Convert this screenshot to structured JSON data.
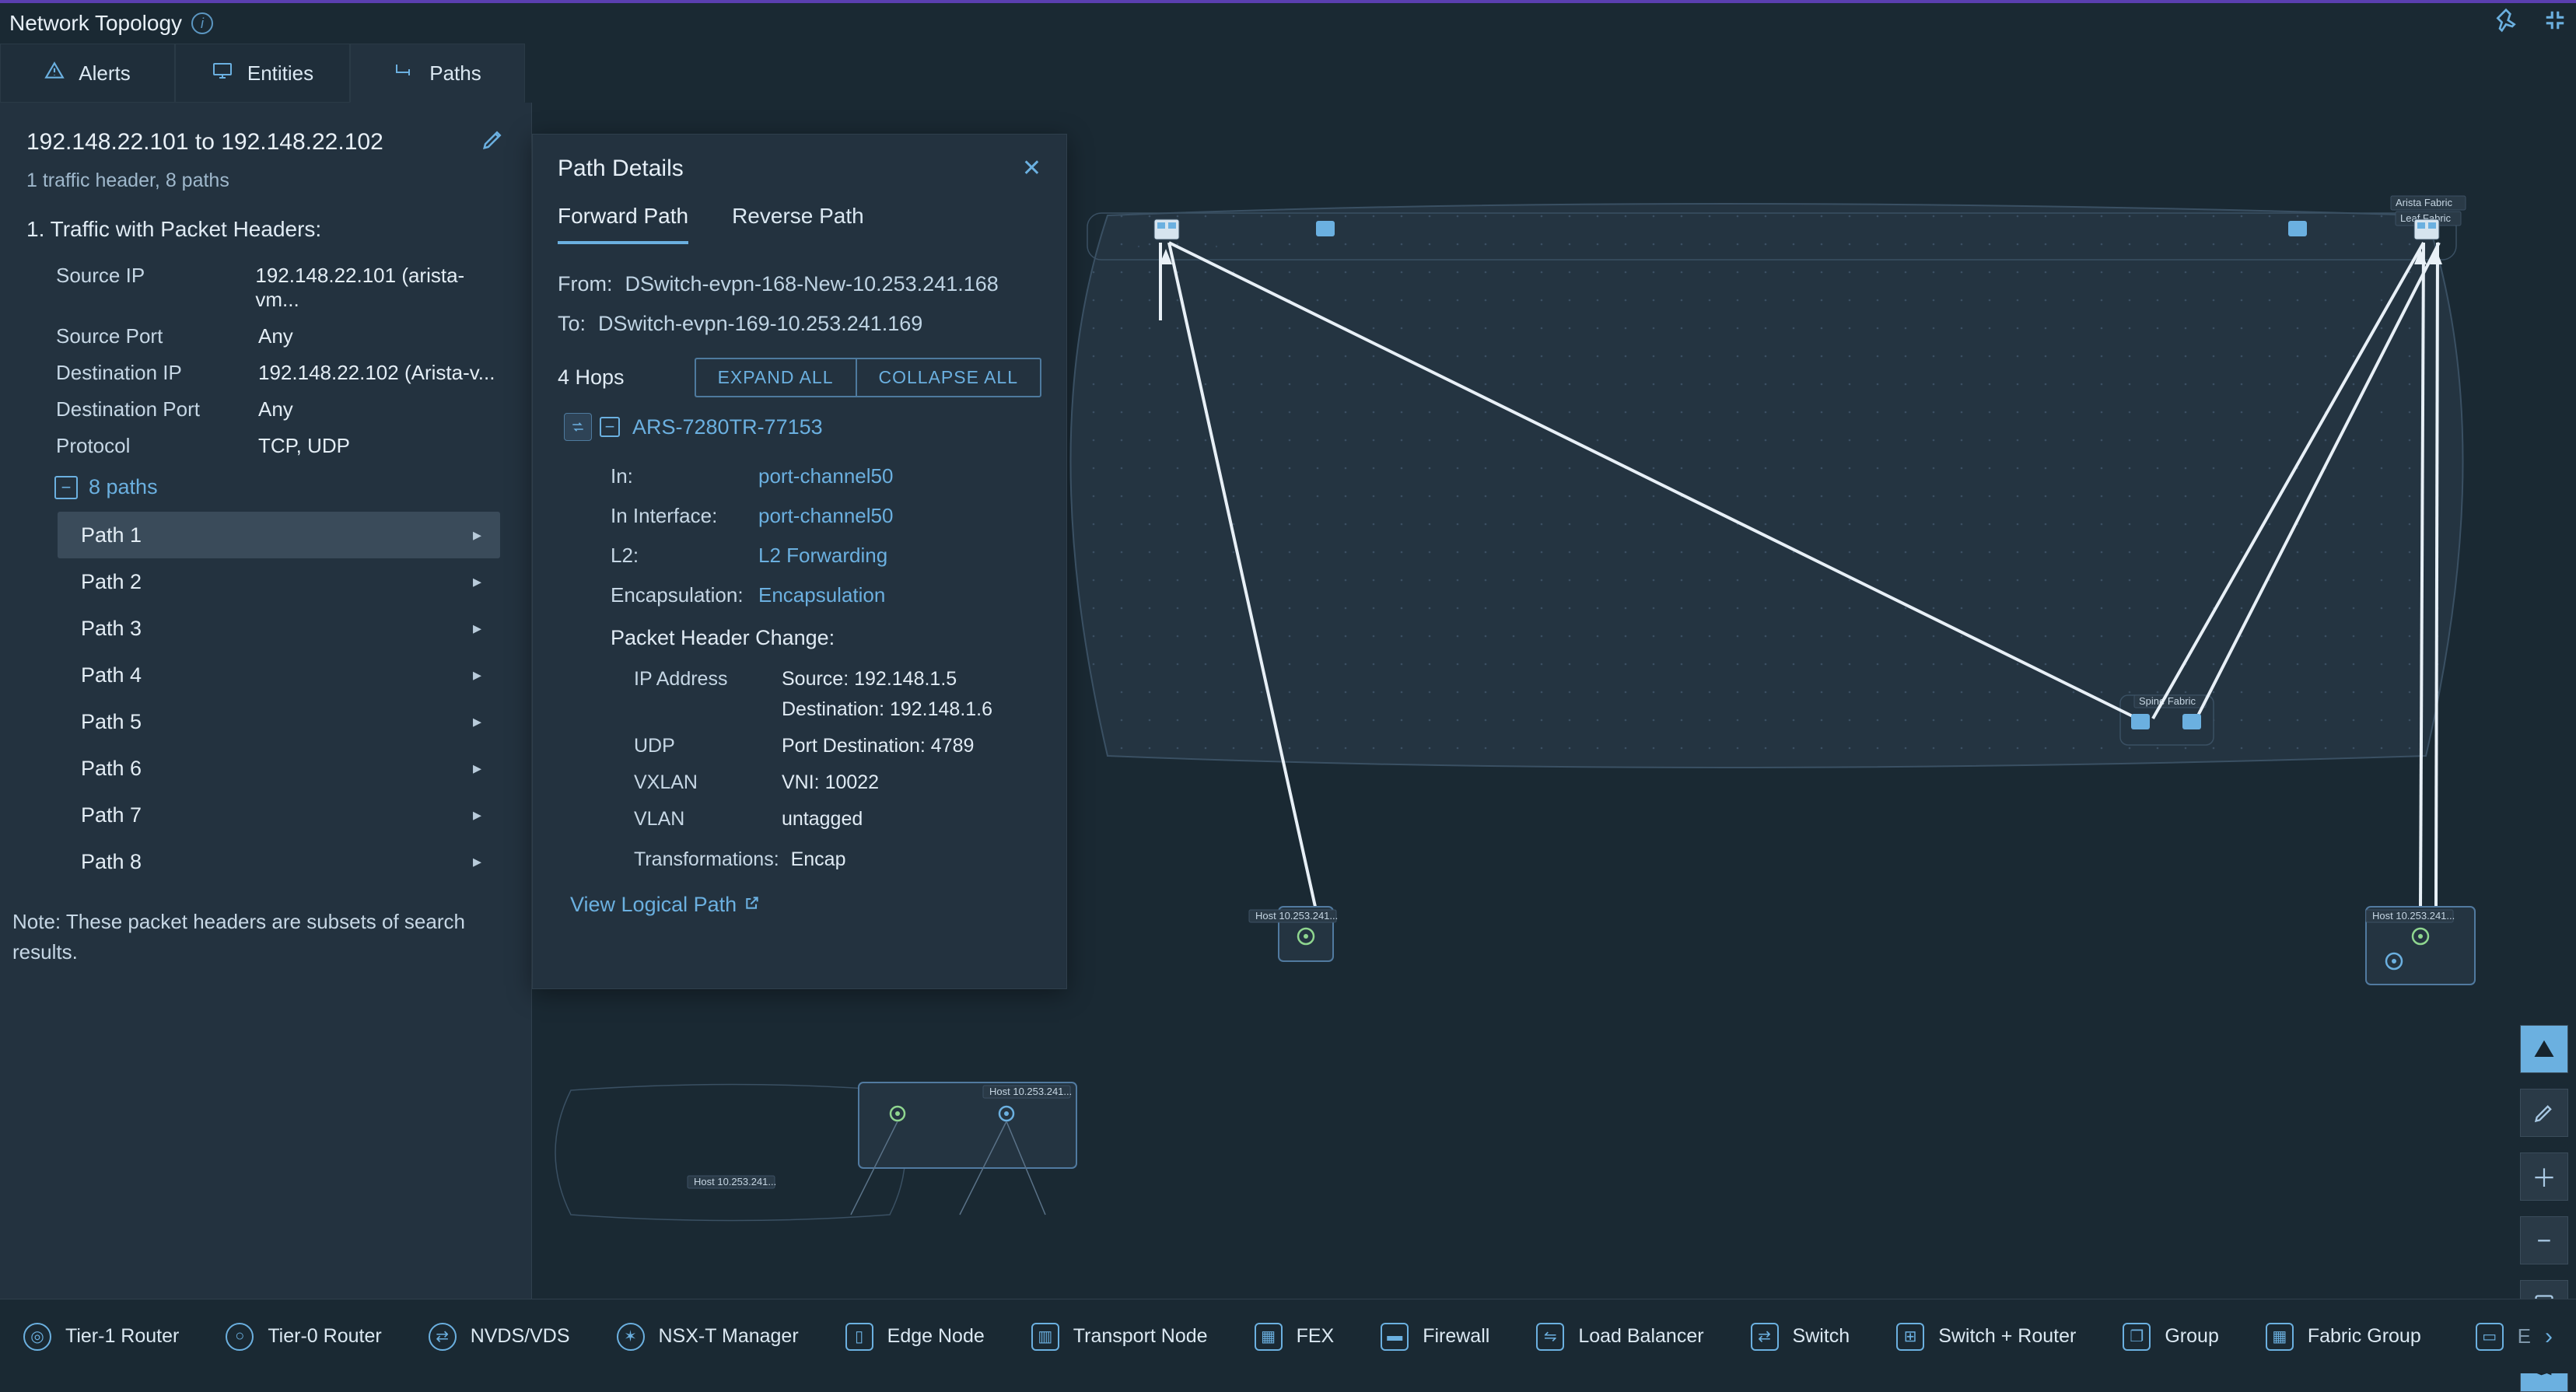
{
  "header": {
    "title": "Network Topology"
  },
  "tabs": {
    "alerts": "Alerts",
    "entities": "Entities",
    "paths": "Paths"
  },
  "leftPanel": {
    "title": "192.148.22.101 to 192.148.22.102",
    "sub": "1 traffic header, 8 paths",
    "sectionTitle": "1. Traffic with Packet Headers:",
    "kv": [
      {
        "k": "Source IP",
        "v": "192.148.22.101 (arista-vm..."
      },
      {
        "k": "Source Port",
        "v": "Any"
      },
      {
        "k": "Destination IP",
        "v": "192.148.22.102 (Arista-v..."
      },
      {
        "k": "Destination Port",
        "v": "Any"
      },
      {
        "k": "Protocol",
        "v": "TCP, UDP"
      }
    ],
    "pathsLabel": "8 paths",
    "paths": [
      "Path 1",
      "Path 2",
      "Path 3",
      "Path 4",
      "Path 5",
      "Path 6",
      "Path 7",
      "Path 8"
    ],
    "note": "Note: These packet headers are subsets of search results."
  },
  "details": {
    "title": "Path Details",
    "tabs": {
      "fwd": "Forward Path",
      "rev": "Reverse Path"
    },
    "fromLabel": "From:",
    "from": "DSwitch-evpn-168-New-10.253.241.168",
    "toLabel": "To:",
    "to": "DSwitch-evpn-169-10.253.241.169",
    "hops": "4 Hops",
    "expand": "EXPAND ALL",
    "collapse": "COLLAPSE ALL",
    "hopName": "ARS-7280TR-77153",
    "hopRows": [
      {
        "k": "In:",
        "v": "port-channel50"
      },
      {
        "k": "In Interface:",
        "v": "port-channel50"
      },
      {
        "k": "L2:",
        "v": "L2 Forwarding"
      },
      {
        "k": "Encapsulation:",
        "v": "Encapsulation"
      }
    ],
    "phcTitle": "Packet Header Change:",
    "phc": {
      "ipLabel": "IP Address",
      "ipSrc": "Source: 192.148.1.5",
      "ipDst": "Destination: 192.148.1.6",
      "udpLabel": "UDP",
      "udpVal": "Port Destination: 4789",
      "vxlanLabel": "VXLAN",
      "vxlanVal": "VNI: 10022",
      "vlanLabel": "VLAN",
      "vlanVal": "untagged"
    },
    "transformLabel": "Transformations:",
    "transformVal": "Encap",
    "viewLogical": "View Logical Path"
  },
  "topology": {
    "aristaFabric": "Arista Fabric",
    "leafFabric": "Leaf Fabric",
    "spineFabric": "Spine Fabric",
    "hostA": "Host 10.253.241...",
    "hostB": "Host 10.253.241...",
    "miniHostA": "Host 10.253.241...",
    "miniHostB": "Host 10.253.241..."
  },
  "legend": {
    "items": [
      "Tier-1 Router",
      "Tier-0 Router",
      "NVDS/VDS",
      "NSX-T Manager",
      "Edge Node",
      "Transport Node",
      "FEX",
      "Firewall",
      "Load Balancer",
      "Switch",
      "Switch + Router",
      "Group",
      "Fabric Group"
    ],
    "last": "E"
  }
}
